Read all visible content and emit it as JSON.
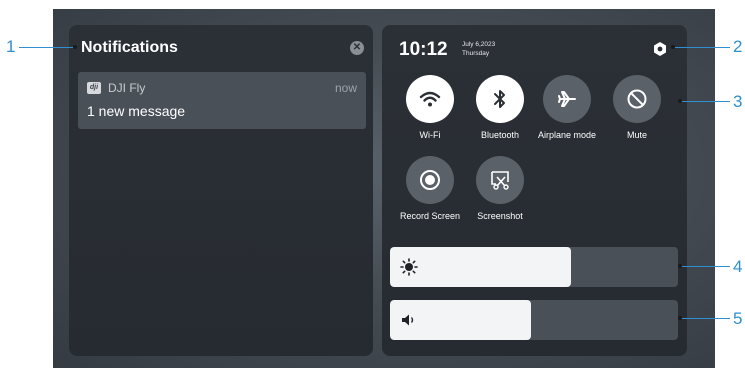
{
  "notifications": {
    "title": "Notifications",
    "close_icon": "close-icon",
    "items": [
      {
        "app_icon": "dji-app-icon",
        "app_name": "DJI Fly",
        "time": "now",
        "message": "1 new message"
      }
    ]
  },
  "control_center": {
    "time": "10:12",
    "date": "July 6,2023",
    "weekday": "Thursday",
    "settings_icon": "settings-icon",
    "toggles": [
      {
        "label": "Wi-Fi",
        "icon": "wifi-icon",
        "on": true
      },
      {
        "label": "Bluetooth",
        "icon": "bluetooth-icon",
        "on": true
      },
      {
        "label": "Airplane mode",
        "icon": "airplane-icon",
        "on": false
      },
      {
        "label": "Mute",
        "icon": "mute-icon",
        "on": false
      },
      {
        "label": "Record Screen",
        "icon": "record-icon",
        "on": false
      },
      {
        "label": "Screenshot",
        "icon": "screenshot-icon",
        "on": false
      }
    ],
    "brightness": {
      "icon": "brightness-icon",
      "level": 0.63
    },
    "volume": {
      "icon": "volume-icon",
      "level": 0.49
    }
  },
  "callouts": [
    "1",
    "2",
    "3",
    "4",
    "5"
  ],
  "colors": {
    "accent": "#2f8fd0",
    "panel": "#2a2f35",
    "toggle_on": "#ffffff",
    "toggle_off": "#5b6168"
  }
}
